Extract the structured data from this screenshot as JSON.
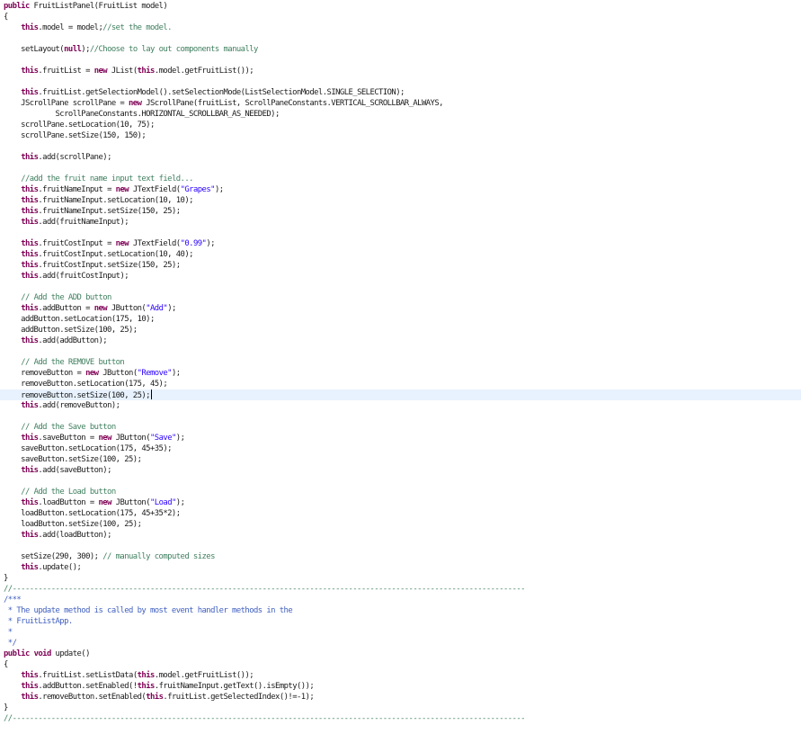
{
  "editor": {
    "caret_line": 36,
    "lines": [
      [
        {
          "t": "kw",
          "v": "public"
        },
        {
          "t": "",
          "v": " FruitListPanel(FruitList model)"
        }
      ],
      [
        {
          "t": "",
          "v": "{"
        }
      ],
      [
        {
          "t": "",
          "v": "    "
        },
        {
          "t": "kw",
          "v": "this"
        },
        {
          "t": "",
          "v": ".model = model;"
        },
        {
          "t": "cm",
          "v": "//set the model."
        }
      ],
      [],
      [
        {
          "t": "",
          "v": "    setLayout("
        },
        {
          "t": "kw",
          "v": "null"
        },
        {
          "t": "",
          "v": ");"
        },
        {
          "t": "cm",
          "v": "//Choose to lay out components manually"
        }
      ],
      [],
      [
        {
          "t": "",
          "v": "    "
        },
        {
          "t": "kw",
          "v": "this"
        },
        {
          "t": "",
          "v": ".fruitList = "
        },
        {
          "t": "kw",
          "v": "new"
        },
        {
          "t": "",
          "v": " JList("
        },
        {
          "t": "kw",
          "v": "this"
        },
        {
          "t": "",
          "v": ".model.getFruitList());"
        }
      ],
      [],
      [
        {
          "t": "",
          "v": "    "
        },
        {
          "t": "kw",
          "v": "this"
        },
        {
          "t": "",
          "v": ".fruitList.getSelectionModel().setSelectionMode(ListSelectionModel.SINGLE_SELECTION);"
        }
      ],
      [
        {
          "t": "",
          "v": "    JScrollPane scrollPane = "
        },
        {
          "t": "kw",
          "v": "new"
        },
        {
          "t": "",
          "v": " JScrollPane(fruitList, ScrollPaneConstants.VERTICAL_SCROLLBAR_ALWAYS,"
        }
      ],
      [
        {
          "t": "",
          "v": "            ScrollPaneConstants.HORIZONTAL_SCROLLBAR_AS_NEEDED);"
        }
      ],
      [
        {
          "t": "",
          "v": "    scrollPane.setLocation(10, 75);"
        }
      ],
      [
        {
          "t": "",
          "v": "    scrollPane.setSize(150, 150);"
        }
      ],
      [],
      [
        {
          "t": "",
          "v": "    "
        },
        {
          "t": "kw",
          "v": "this"
        },
        {
          "t": "",
          "v": ".add(scrollPane);"
        }
      ],
      [],
      [
        {
          "t": "",
          "v": "    "
        },
        {
          "t": "cm",
          "v": "//add the fruit name input text field..."
        }
      ],
      [
        {
          "t": "",
          "v": "    "
        },
        {
          "t": "kw",
          "v": "this"
        },
        {
          "t": "",
          "v": ".fruitNameInput = "
        },
        {
          "t": "kw",
          "v": "new"
        },
        {
          "t": "",
          "v": " JTextField("
        },
        {
          "t": "st",
          "v": "\"Grapes\""
        },
        {
          "t": "",
          "v": ");"
        }
      ],
      [
        {
          "t": "",
          "v": "    "
        },
        {
          "t": "kw",
          "v": "this"
        },
        {
          "t": "",
          "v": ".fruitNameInput.setLocation(10, 10);"
        }
      ],
      [
        {
          "t": "",
          "v": "    "
        },
        {
          "t": "kw",
          "v": "this"
        },
        {
          "t": "",
          "v": ".fruitNameInput.setSize(150, 25);"
        }
      ],
      [
        {
          "t": "",
          "v": "    "
        },
        {
          "t": "kw",
          "v": "this"
        },
        {
          "t": "",
          "v": ".add(fruitNameInput);"
        }
      ],
      [],
      [
        {
          "t": "",
          "v": "    "
        },
        {
          "t": "kw",
          "v": "this"
        },
        {
          "t": "",
          "v": ".fruitCostInput = "
        },
        {
          "t": "kw",
          "v": "new"
        },
        {
          "t": "",
          "v": " JTextField("
        },
        {
          "t": "st",
          "v": "\"0.99\""
        },
        {
          "t": "",
          "v": ");"
        }
      ],
      [
        {
          "t": "",
          "v": "    "
        },
        {
          "t": "kw",
          "v": "this"
        },
        {
          "t": "",
          "v": ".fruitCostInput.setLocation(10, 40);"
        }
      ],
      [
        {
          "t": "",
          "v": "    "
        },
        {
          "t": "kw",
          "v": "this"
        },
        {
          "t": "",
          "v": ".fruitCostInput.setSize(150, 25);"
        }
      ],
      [
        {
          "t": "",
          "v": "    "
        },
        {
          "t": "kw",
          "v": "this"
        },
        {
          "t": "",
          "v": ".add(fruitCostInput);"
        }
      ],
      [],
      [
        {
          "t": "",
          "v": "    "
        },
        {
          "t": "cm",
          "v": "// Add the ADD button"
        }
      ],
      [
        {
          "t": "",
          "v": "    "
        },
        {
          "t": "kw",
          "v": "this"
        },
        {
          "t": "",
          "v": ".addButton = "
        },
        {
          "t": "kw",
          "v": "new"
        },
        {
          "t": "",
          "v": " JButton("
        },
        {
          "t": "st",
          "v": "\"Add\""
        },
        {
          "t": "",
          "v": ");"
        }
      ],
      [
        {
          "t": "",
          "v": "    addButton.setLocation(175, 10);"
        }
      ],
      [
        {
          "t": "",
          "v": "    addButton.setSize(100, 25);"
        }
      ],
      [
        {
          "t": "",
          "v": "    "
        },
        {
          "t": "kw",
          "v": "this"
        },
        {
          "t": "",
          "v": ".add(addButton);"
        }
      ],
      [],
      [
        {
          "t": "",
          "v": "    "
        },
        {
          "t": "cm",
          "v": "// Add the REMOVE button"
        }
      ],
      [
        {
          "t": "",
          "v": "    removeButton = "
        },
        {
          "t": "kw",
          "v": "new"
        },
        {
          "t": "",
          "v": " JButton("
        },
        {
          "t": "st",
          "v": "\"Remove\""
        },
        {
          "t": "",
          "v": ");"
        }
      ],
      [
        {
          "t": "",
          "v": "    removeButton.setLocation(175, 45);"
        }
      ],
      [
        {
          "t": "",
          "v": "    removeButton.setSize(100, 25);"
        }
      ],
      [
        {
          "t": "",
          "v": "    "
        },
        {
          "t": "kw",
          "v": "this"
        },
        {
          "t": "",
          "v": ".add(removeButton);"
        }
      ],
      [],
      [
        {
          "t": "",
          "v": "    "
        },
        {
          "t": "cm",
          "v": "// Add the Save button"
        }
      ],
      [
        {
          "t": "",
          "v": "    "
        },
        {
          "t": "kw",
          "v": "this"
        },
        {
          "t": "",
          "v": ".saveButton = "
        },
        {
          "t": "kw",
          "v": "new"
        },
        {
          "t": "",
          "v": " JButton("
        },
        {
          "t": "st",
          "v": "\"Save\""
        },
        {
          "t": "",
          "v": ");"
        }
      ],
      [
        {
          "t": "",
          "v": "    saveButton.setLocation(175, 45+35);"
        }
      ],
      [
        {
          "t": "",
          "v": "    saveButton.setSize(100, 25);"
        }
      ],
      [
        {
          "t": "",
          "v": "    "
        },
        {
          "t": "kw",
          "v": "this"
        },
        {
          "t": "",
          "v": ".add(saveButton);"
        }
      ],
      [],
      [
        {
          "t": "",
          "v": "    "
        },
        {
          "t": "cm",
          "v": "// Add the Load button"
        }
      ],
      [
        {
          "t": "",
          "v": "    "
        },
        {
          "t": "kw",
          "v": "this"
        },
        {
          "t": "",
          "v": ".loadButton = "
        },
        {
          "t": "kw",
          "v": "new"
        },
        {
          "t": "",
          "v": " JButton("
        },
        {
          "t": "st",
          "v": "\"Load\""
        },
        {
          "t": "",
          "v": ");"
        }
      ],
      [
        {
          "t": "",
          "v": "    loadButton.setLocation(175, 45+35*2);"
        }
      ],
      [
        {
          "t": "",
          "v": "    loadButton.setSize(100, 25);"
        }
      ],
      [
        {
          "t": "",
          "v": "    "
        },
        {
          "t": "kw",
          "v": "this"
        },
        {
          "t": "",
          "v": ".add(loadButton);"
        }
      ],
      [],
      [
        {
          "t": "",
          "v": "    setSize(290, 300); "
        },
        {
          "t": "cm",
          "v": "// manually computed sizes"
        }
      ],
      [
        {
          "t": "",
          "v": "    "
        },
        {
          "t": "kw",
          "v": "this"
        },
        {
          "t": "",
          "v": ".update();"
        }
      ],
      [
        {
          "t": "",
          "v": "}"
        }
      ],
      [
        {
          "t": "cm",
          "v": "//-----------------------------------------------------------------------------------------------------------------------"
        }
      ],
      [
        {
          "t": "jd",
          "v": "/***"
        }
      ],
      [
        {
          "t": "jd",
          "v": " * The update method is called by most event handler methods in the"
        }
      ],
      [
        {
          "t": "jd",
          "v": " * FruitListApp."
        }
      ],
      [
        {
          "t": "jd",
          "v": " *"
        }
      ],
      [
        {
          "t": "jd",
          "v": " */"
        }
      ],
      [
        {
          "t": "kw",
          "v": "public"
        },
        {
          "t": "",
          "v": " "
        },
        {
          "t": "kw",
          "v": "void"
        },
        {
          "t": "",
          "v": " update()"
        }
      ],
      [
        {
          "t": "",
          "v": "{"
        }
      ],
      [
        {
          "t": "",
          "v": "    "
        },
        {
          "t": "kw",
          "v": "this"
        },
        {
          "t": "",
          "v": ".fruitList.setListData("
        },
        {
          "t": "kw",
          "v": "this"
        },
        {
          "t": "",
          "v": ".model.getFruitList());"
        }
      ],
      [
        {
          "t": "",
          "v": "    "
        },
        {
          "t": "kw",
          "v": "this"
        },
        {
          "t": "",
          "v": ".addButton.setEnabled(!"
        },
        {
          "t": "kw",
          "v": "this"
        },
        {
          "t": "",
          "v": ".fruitNameInput.getText().isEmpty());"
        }
      ],
      [
        {
          "t": "",
          "v": "    "
        },
        {
          "t": "kw",
          "v": "this"
        },
        {
          "t": "",
          "v": ".removeButton.setEnabled("
        },
        {
          "t": "kw",
          "v": "this"
        },
        {
          "t": "",
          "v": ".fruitList.getSelectedIndex()!=-1);"
        }
      ],
      [
        {
          "t": "",
          "v": "}"
        }
      ],
      [
        {
          "t": "cm",
          "v": "//-----------------------------------------------------------------------------------------------------------------------"
        }
      ]
    ]
  }
}
